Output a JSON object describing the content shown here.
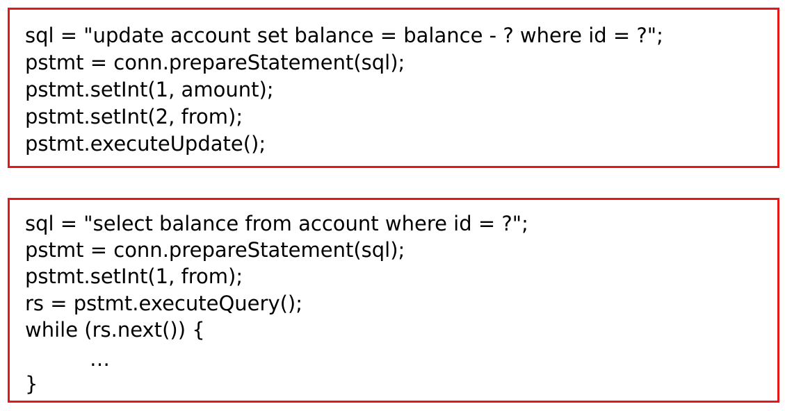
{
  "update_block": {
    "lines": [
      "sql = \"update account set balance = balance - ? where id = ?\";",
      "pstmt = conn.prepareStatement(sql);",
      "pstmt.setInt(1, amount);",
      "pstmt.setInt(2, from);",
      "pstmt.executeUpdate();"
    ]
  },
  "select_block": {
    "lines": [
      "sql = \"select balance from account where id = ?\";",
      "pstmt = conn.prepareStatement(sql);",
      "pstmt.setInt(1, from);",
      "rs = pstmt.executeQuery();",
      "while (rs.next()) {",
      "…",
      "}"
    ]
  },
  "colors": {
    "border": "#e8141c",
    "text": "#000000",
    "background": "#ffffff"
  }
}
